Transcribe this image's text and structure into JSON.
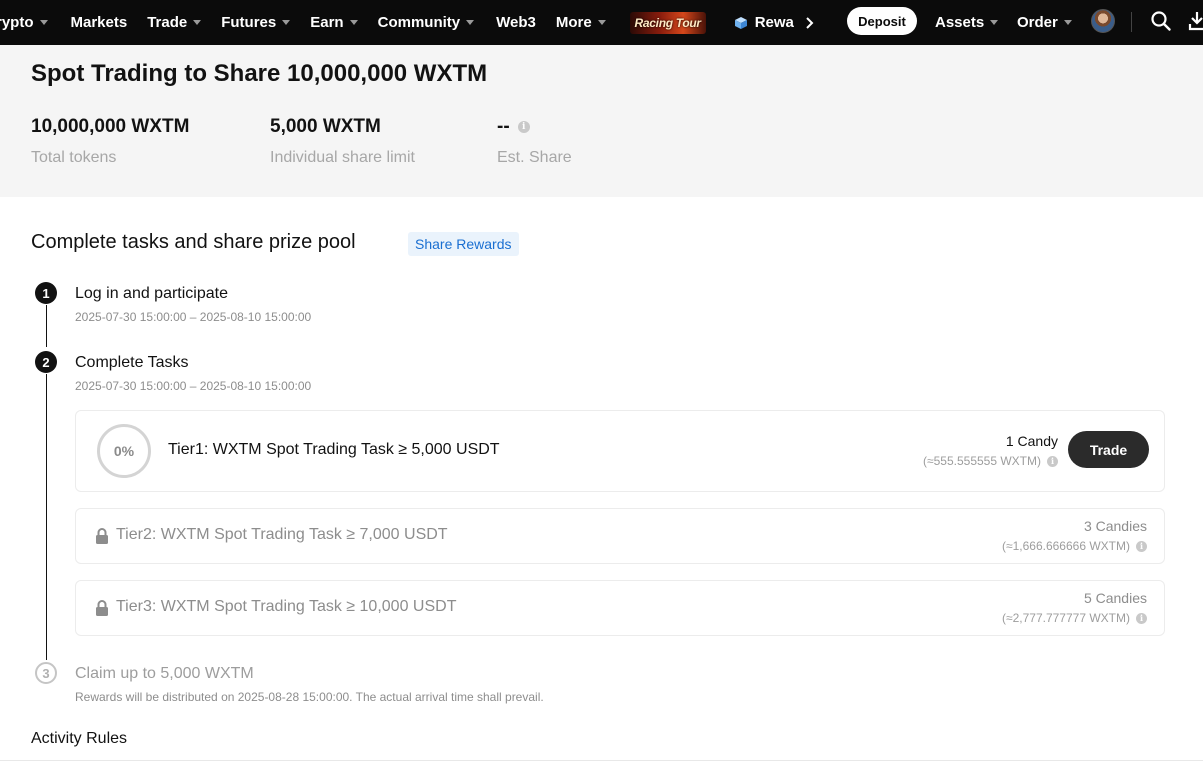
{
  "nav": {
    "items": [
      {
        "label": "rypto",
        "caret": true
      },
      {
        "label": "Markets",
        "caret": false
      },
      {
        "label": "Trade",
        "caret": true
      },
      {
        "label": "Futures",
        "caret": true
      },
      {
        "label": "Earn",
        "caret": true
      },
      {
        "label": "Community",
        "caret": true
      },
      {
        "label": "Web3",
        "caret": false
      },
      {
        "label": "More",
        "caret": true
      }
    ],
    "promo_label": "Racing Tour",
    "rewards_label": "Rewa",
    "deposit_label": "Deposit",
    "assets_label": "Assets",
    "order_label": "Order",
    "icons": [
      "cube-icon",
      "chevron-right-icon",
      "avatar",
      "search-icon",
      "download-icon"
    ]
  },
  "hero": {
    "title": "Spot Trading to Share 10,000,000 WXTM",
    "stats": [
      {
        "value": "10,000,000 WXTM",
        "label": "Total tokens"
      },
      {
        "value": "5,000 WXTM",
        "label": "Individual share limit"
      },
      {
        "value": "--",
        "label": "Est. Share"
      }
    ]
  },
  "tasks": {
    "title": "Complete tasks and share prize pool",
    "badge": "Share Rewards",
    "steps": [
      {
        "num": "1",
        "title": "Log in and participate",
        "sub": "2025-07-30 15:00:00 – 2025-08-10 15:00:00"
      },
      {
        "num": "2",
        "title": "Complete Tasks",
        "sub": "2025-07-30 15:00:00 – 2025-08-10 15:00:00"
      },
      {
        "num": "3",
        "title": "Claim up to 5,000 WXTM",
        "sub": "Rewards will be distributed on 2025-08-28 15:00:00. The actual arrival time shall prevail."
      }
    ],
    "tiers": [
      {
        "progress": "0%",
        "name": "Tier1: WXTM Spot Trading Task ≥ 5,000 USDT",
        "reward": "1 Candy",
        "reward_sub": "(≈555.555555 WXTM)",
        "button": "Trade"
      },
      {
        "name": "Tier2: WXTM Spot Trading Task ≥ 7,000 USDT",
        "reward": "3 Candies",
        "reward_sub": "(≈1,666.666666 WXTM)"
      },
      {
        "name": "Tier3: WXTM Spot Trading Task ≥ 10,000 USDT",
        "reward": "5 Candies",
        "reward_sub": "(≈2,777.777777 WXTM)"
      }
    ]
  },
  "rules": {
    "title": "Activity Rules"
  },
  "info_glyph": "i"
}
